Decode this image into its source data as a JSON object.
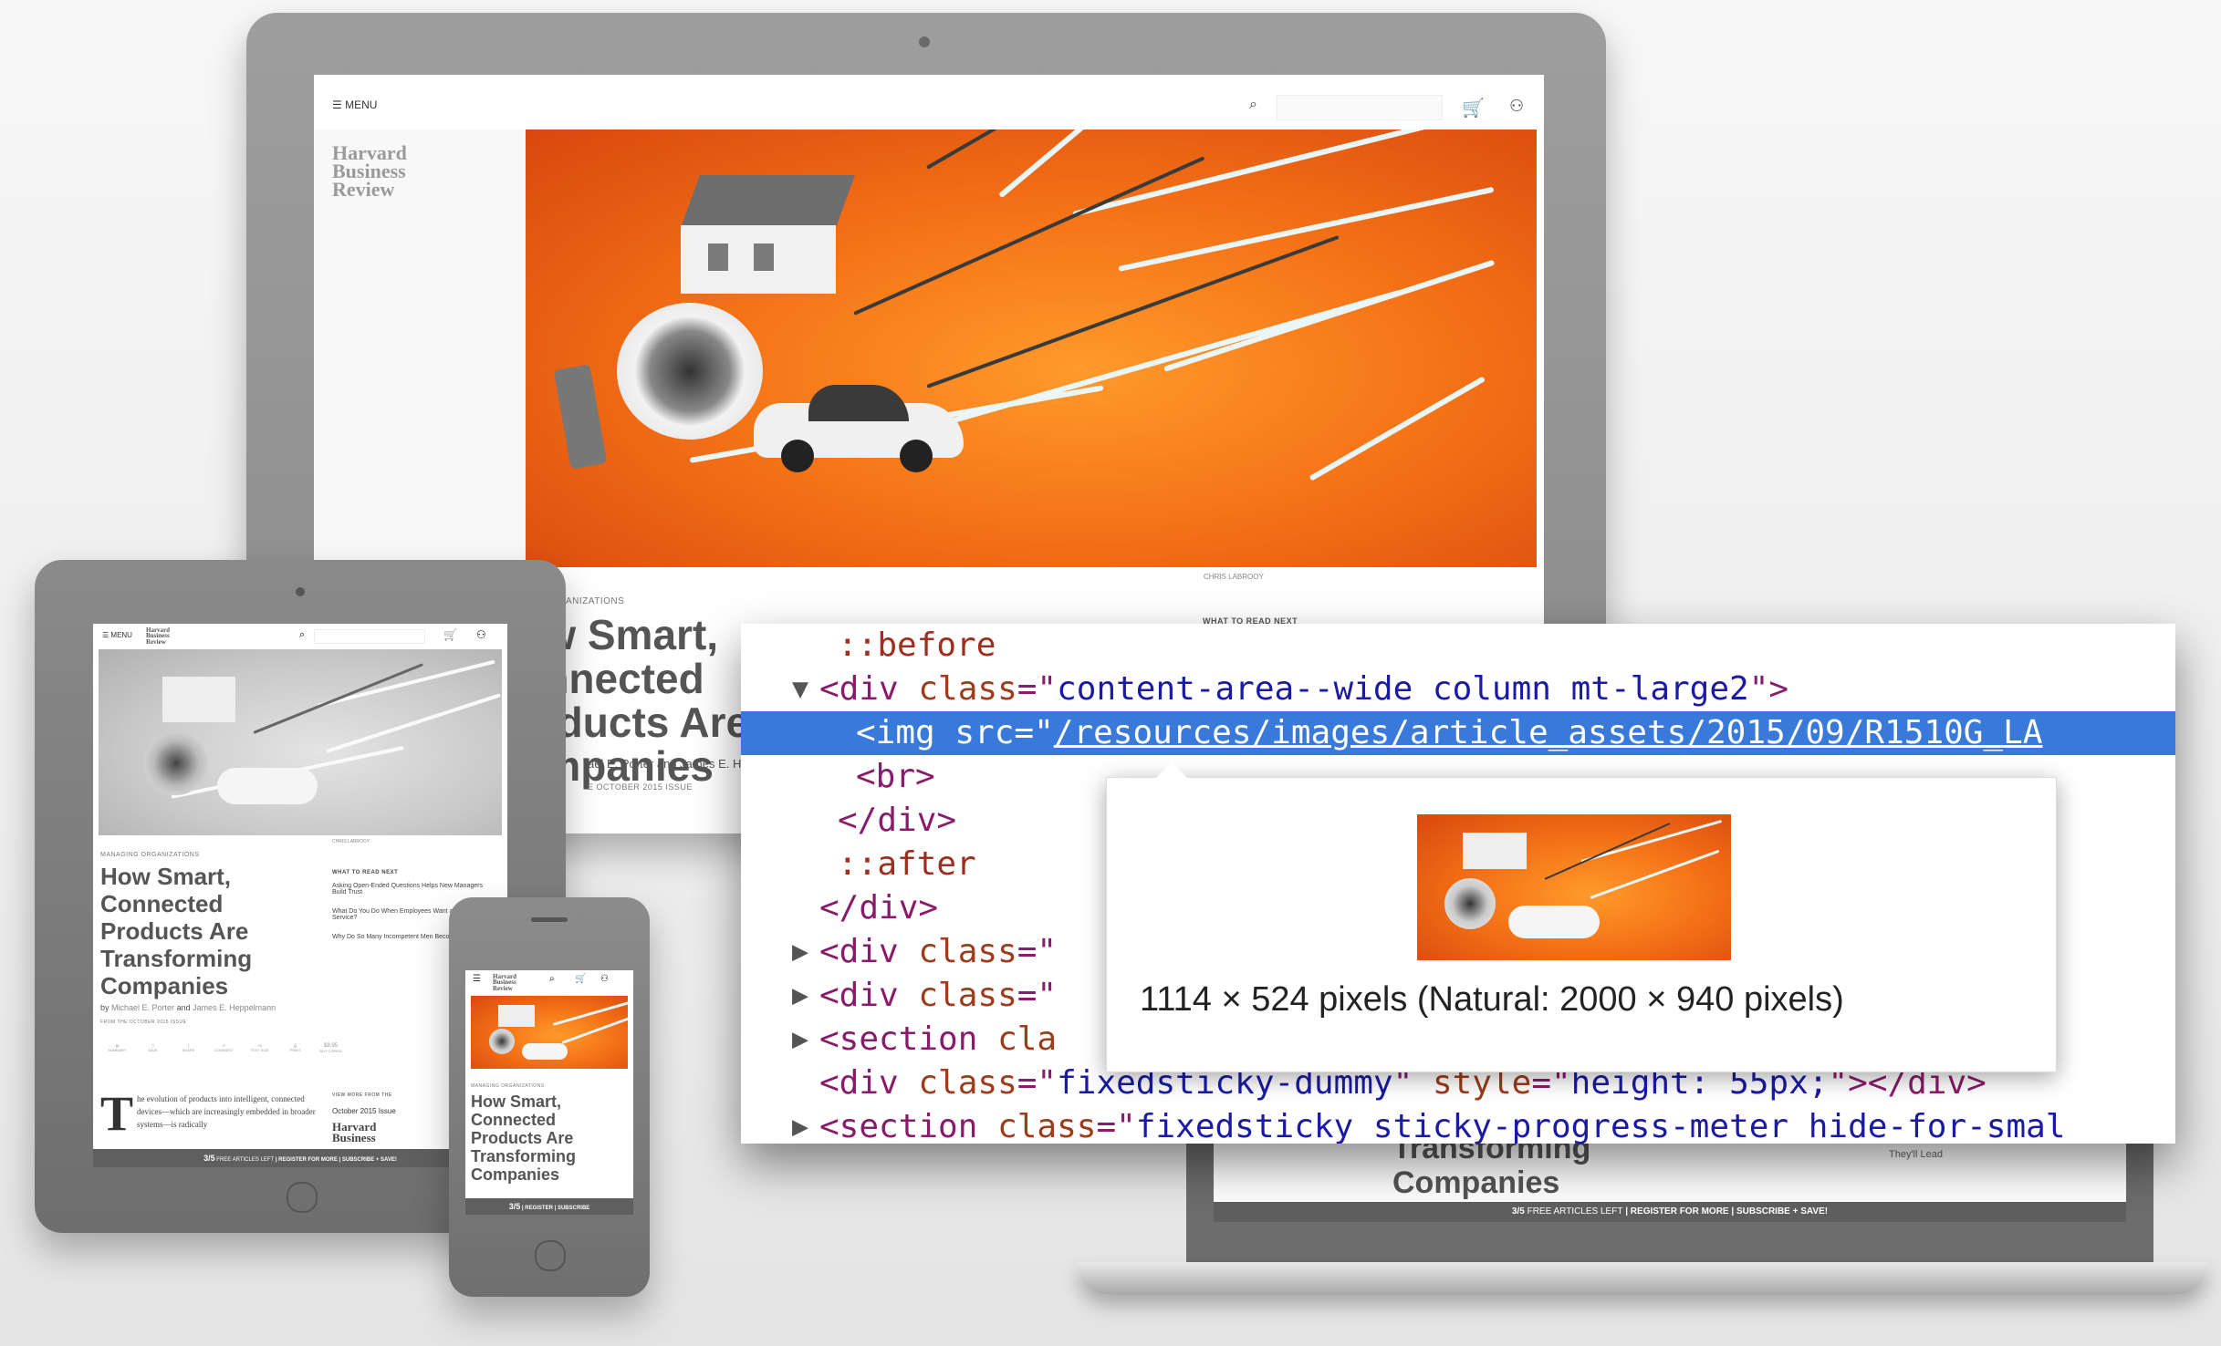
{
  "desktop": {
    "menu_label": "MENU",
    "logo": [
      "Harvard",
      "Business",
      "Review"
    ],
    "photo_credit": "CHRIS LABROOY",
    "kicker": "MANAGING ORGANIZATIONS",
    "headline_lines": [
      "How Smart, Connected",
      "Products Are",
      "Companies"
    ],
    "byline_partial": "ael E. Porter and James E. Hep",
    "issue": "E OCTOBER 2015 ISSUE",
    "what_to_read_next": "WHAT TO READ NEXT"
  },
  "tablet": {
    "menu_label": "MENU",
    "logo": [
      "Harvard",
      "Business",
      "Review"
    ],
    "photo_credit": "CHRIS LABROOY",
    "kicker": "MANAGING ORGANIZATIONS",
    "headline": "How Smart, Connected Products Are Transforming Companies",
    "byline_prefix": "by",
    "author1": "Michael E. Porter",
    "byline_and": "and",
    "author2": "James E. Heppelmann",
    "issue": "FROM THE OCTOBER 2015 ISSUE",
    "what_to_read_next": "WHAT TO READ NEXT",
    "read_next": [
      "Asking Open-Ended Questions Helps New Managers Build Trust",
      "What Do You Do When Employees Want a Free Cloud Service?",
      "Why Do So Many Incompetent Men Become Leaders?"
    ],
    "tools": [
      "SUMMARY",
      "SAVE",
      "SHARE",
      "COMMENT",
      "TEXT SIZE",
      "PRINT",
      "BUY COPIES"
    ],
    "price": "$8.95",
    "body_dropcap": "T",
    "body_text": "he evolution of products into intelligent, connected devices—which are increasingly embedded in broader systems—is radically",
    "view_more": "VIEW MORE FROM THE",
    "view_more_issue": "October 2015 Issue",
    "promo_count": "3/5",
    "promo_text": "FREE ARTICLES LEFT",
    "promo_register": "REGISTER FOR MORE",
    "promo_subscribe": "SUBSCRIBE + SAVE!"
  },
  "phone": {
    "logo": [
      "Harvard",
      "Business",
      "Review"
    ],
    "kicker": "MANAGING ORGANIZATIONS",
    "headline": "How Smart, Connected Products Are Transforming Companies",
    "promo_count": "3/5",
    "promo_register": "REGISTER",
    "promo_subscribe": "SUBSCRIBE"
  },
  "laptop": {
    "headline_lines": [
      "Transforming",
      "Companies"
    ],
    "side_text": "They'll Lead",
    "promo_count": "3/5",
    "promo_text": "FREE ARTICLES LEFT",
    "promo_register": "REGISTER FOR MORE",
    "promo_subscribe": "SUBSCRIBE + SAVE!"
  },
  "devtools": {
    "lines": [
      {
        "indent": 5,
        "arrow": "",
        "parts": [
          {
            "c": "pseudo",
            "t": "::before"
          }
        ]
      },
      {
        "indent": 4,
        "arrow": "▼",
        "parts": [
          {
            "c": "t-tag",
            "t": "<div "
          },
          {
            "c": "t-attr",
            "t": "class"
          },
          {
            "c": "t-tag",
            "t": "=\""
          },
          {
            "c": "t-val",
            "t": "content-area--wide column mt-large2"
          },
          {
            "c": "t-tag",
            "t": "\">"
          }
        ]
      },
      {
        "indent": 6,
        "arrow": "",
        "selected": true,
        "parts": [
          {
            "c": "t-tag",
            "t": "<img "
          },
          {
            "c": "t-attr",
            "t": "src"
          },
          {
            "c": "t-tag",
            "t": "=\""
          },
          {
            "c": "t-val u",
            "t": "/resources/images/article_assets/2015/09/R1510G_LA"
          }
        ]
      },
      {
        "indent": 6,
        "arrow": "",
        "parts": [
          {
            "c": "t-tag",
            "t": "<br>"
          }
        ]
      },
      {
        "indent": 5,
        "arrow": "",
        "parts": [
          {
            "c": "t-tag",
            "t": "</div>"
          }
        ]
      },
      {
        "indent": 5,
        "arrow": "",
        "parts": [
          {
            "c": "pseudo",
            "t": "::after"
          }
        ]
      },
      {
        "indent": 4,
        "arrow": "",
        "parts": [
          {
            "c": "t-tag",
            "t": "</div>"
          }
        ]
      },
      {
        "indent": 4,
        "arrow": "▶",
        "parts": [
          {
            "c": "t-tag",
            "t": "<div "
          },
          {
            "c": "t-attr",
            "t": "class"
          },
          {
            "c": "t-tag",
            "t": "=\""
          }
        ]
      },
      {
        "indent": 4,
        "arrow": "▶",
        "parts": [
          {
            "c": "t-tag",
            "t": "<div "
          },
          {
            "c": "t-attr",
            "t": "class"
          },
          {
            "c": "t-tag",
            "t": "=\""
          }
        ]
      },
      {
        "indent": 4,
        "arrow": "▶",
        "parts": [
          {
            "c": "t-tag",
            "t": "<section "
          },
          {
            "c": "t-attr",
            "t": "cla"
          }
        ]
      },
      {
        "indent": 4,
        "arrow": "",
        "parts": [
          {
            "c": "t-tag",
            "t": "<div "
          },
          {
            "c": "t-attr",
            "t": "class"
          },
          {
            "c": "t-tag",
            "t": "=\""
          },
          {
            "c": "t-val",
            "t": "fixedsticky-dummy"
          },
          {
            "c": "t-tag",
            "t": "\" "
          },
          {
            "c": "t-attr",
            "t": "style"
          },
          {
            "c": "t-tag",
            "t": "=\""
          },
          {
            "c": "t-val",
            "t": "height: 55px;"
          },
          {
            "c": "t-tag",
            "t": "\"></div>"
          }
        ]
      },
      {
        "indent": 4,
        "arrow": "▶",
        "parts": [
          {
            "c": "t-tag",
            "t": "<section "
          },
          {
            "c": "t-attr",
            "t": "class"
          },
          {
            "c": "t-tag",
            "t": "=\""
          },
          {
            "c": "t-val",
            "t": "fixedsticky sticky-progress-meter hide-for-smal"
          }
        ]
      }
    ],
    "tooltip_text": "1114 × 524 pixels (Natural: 2000 × 940 pixels)"
  }
}
